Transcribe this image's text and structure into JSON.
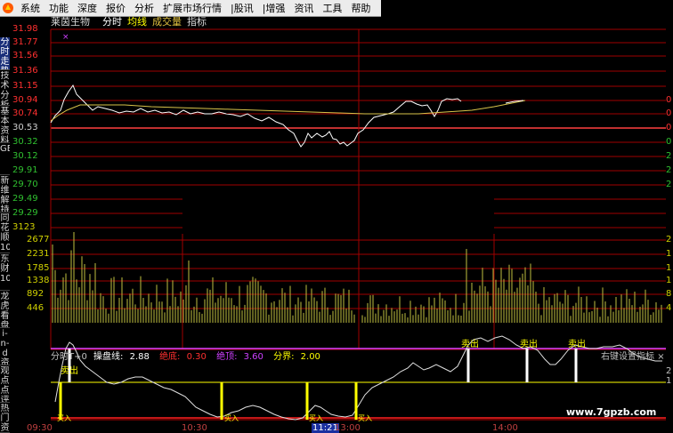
{
  "menu": {
    "items": [
      "系统",
      "功能",
      "深度",
      "报价",
      "分析",
      "扩展市场行情",
      "|股讯",
      "|增强",
      "资讯",
      "工具",
      "帮助"
    ]
  },
  "sidebar": {
    "tabs": [
      "分时走势",
      "技术分析",
      "基本资料",
      "GET",
      "新维解持",
      "同花顺10",
      "东财10",
      "龙虎看盘",
      "i-n-d资讯",
      "观点点评",
      "热门资讯"
    ]
  },
  "header": {
    "stock_name": "莱茵生物",
    "mode": "分时",
    "avg_label": "均线",
    "vol_label": "成交量",
    "ind_label": "指标"
  },
  "price_axis": {
    "labels": [
      "31.98",
      "31.77",
      "31.56",
      "31.36",
      "31.15",
      "30.94",
      "30.74",
      "30.53",
      "30.32",
      "30.12",
      "29.91",
      "29.70",
      "29.49",
      "29.29",
      "3123"
    ],
    "right_labels": [
      "0",
      "0",
      "0",
      "0",
      "2",
      "2",
      "2"
    ],
    "baseline": "30.53"
  },
  "volume_axis": {
    "labels": [
      "2677",
      "2231",
      "1785",
      "1338",
      "892",
      "446"
    ],
    "right_labels": [
      "2",
      "1",
      "1",
      "1",
      "8",
      "4"
    ]
  },
  "indicator": {
    "name": "分时T+0",
    "op_label": "操盘线:",
    "op_value": "2.88",
    "abs_bottom_label": "绝底:",
    "abs_bottom_value": "0.30",
    "abs_top_label": "绝顶:",
    "abs_top_value": "3.60",
    "divider_label": "分界:",
    "divider_value": "2.00",
    "settings": "右键设置指标",
    "close": "×",
    "right_labels": [
      "2",
      "1"
    ],
    "sell_label": "卖出",
    "buy_label": "买入"
  },
  "time_axis": {
    "labels": [
      "09:30",
      "10:30",
      "11:21",
      "13:00",
      "14:00"
    ]
  },
  "watermark": "www.7gpzb.com",
  "colors": {
    "grid_red": "#a00000",
    "price_line": "#ffffff",
    "avg_line": "#d8c34a",
    "volume_bar": "#c0c040",
    "magenta": "#d040ff",
    "yellow": "#ffff00",
    "up_red": "#ff3030",
    "down_green": "#30c030"
  }
}
